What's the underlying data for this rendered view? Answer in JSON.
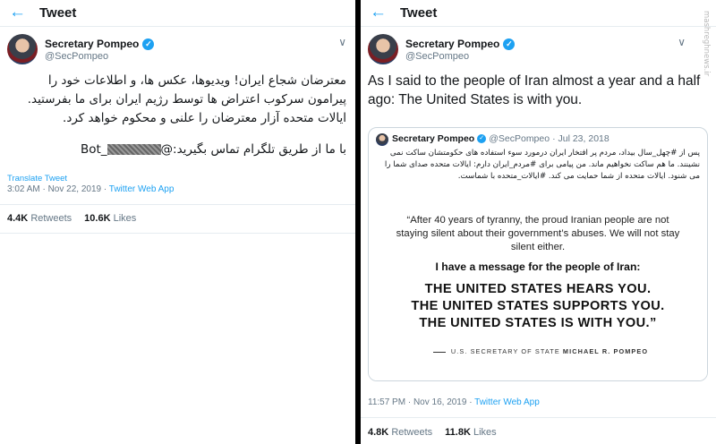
{
  "left_tweet": {
    "header_title": "Tweet",
    "user_name": "Secretary Pompeo",
    "handle": "@SecPompeo",
    "text_lines": [
      "معترضان شجاع ایران! ویدیوها، عکس ها، و اطلاعات خود را",
      "پیرامون سرکوب اعتراض ها توسط رژیم ایران برای ما بفرستید.",
      "ایالات متحده آزار معترضان را علنی و محکوم خواهد کرد."
    ],
    "contact_prefix": "با ما از طریق تلگرام تماس بگیرید:@",
    "contact_suffix": "_Bot",
    "translate_label": "Translate Tweet",
    "timestamp": "3:02 AM · Nov 22, 2019 · ",
    "source": "Twitter Web App",
    "retweets_count": "4.4K",
    "retweets_label": "Retweets",
    "likes_count": "10.6K",
    "likes_label": "Likes"
  },
  "right_tweet": {
    "header_title": "Tweet",
    "user_name": "Secretary Pompeo",
    "handle": "@SecPompeo",
    "text": "As I said to the people of Iran almost a year and a half ago: The United States is with you.",
    "quoted": {
      "user_name": "Secretary Pompeo",
      "handle": "@SecPompeo",
      "date": " · Jul 23, 2018",
      "text": "پس از #چهل_سال بیداد، مردم پر افتخار ایران درمورد سوء استفاده های حکومتشان ساکت نمی نشینند. ما هم ساکت نخواهیم ماند. من پیامی برای #مردم_ایران دارم: ایالات متحده صدای شما را می شنود. ایالات متحده از شما حمایت می کند. #ایالات_متحده با شماست.",
      "card": {
        "quote": "“After 40 years of tyranny, the proud Iranian people are not staying silent about their government’s abuses. We will not stay silent either.",
        "message": "I have a message for the people of Iran:",
        "line1": "THE UNITED STATES HEARS YOU.",
        "line2": "THE UNITED STATES SUPPORTS YOU.",
        "line3": "THE UNITED STATES IS WITH YOU.”",
        "sig_prefix": "U.S. SECRETARY OF STATE ",
        "sig_name": "MICHAEL R. POMPEO"
      }
    },
    "timestamp": "11:57 PM · Nov 16, 2019 · ",
    "source": "Twitter Web App",
    "retweets_count": "4.8K",
    "retweets_label": "Retweets",
    "likes_count": "11.8K",
    "likes_label": "Likes"
  },
  "watermark": "mashreghnews.ir",
  "colors": {
    "accent": "#1da1f2",
    "muted": "#657786",
    "border": "#e6ecf0",
    "divider": "#000000"
  }
}
